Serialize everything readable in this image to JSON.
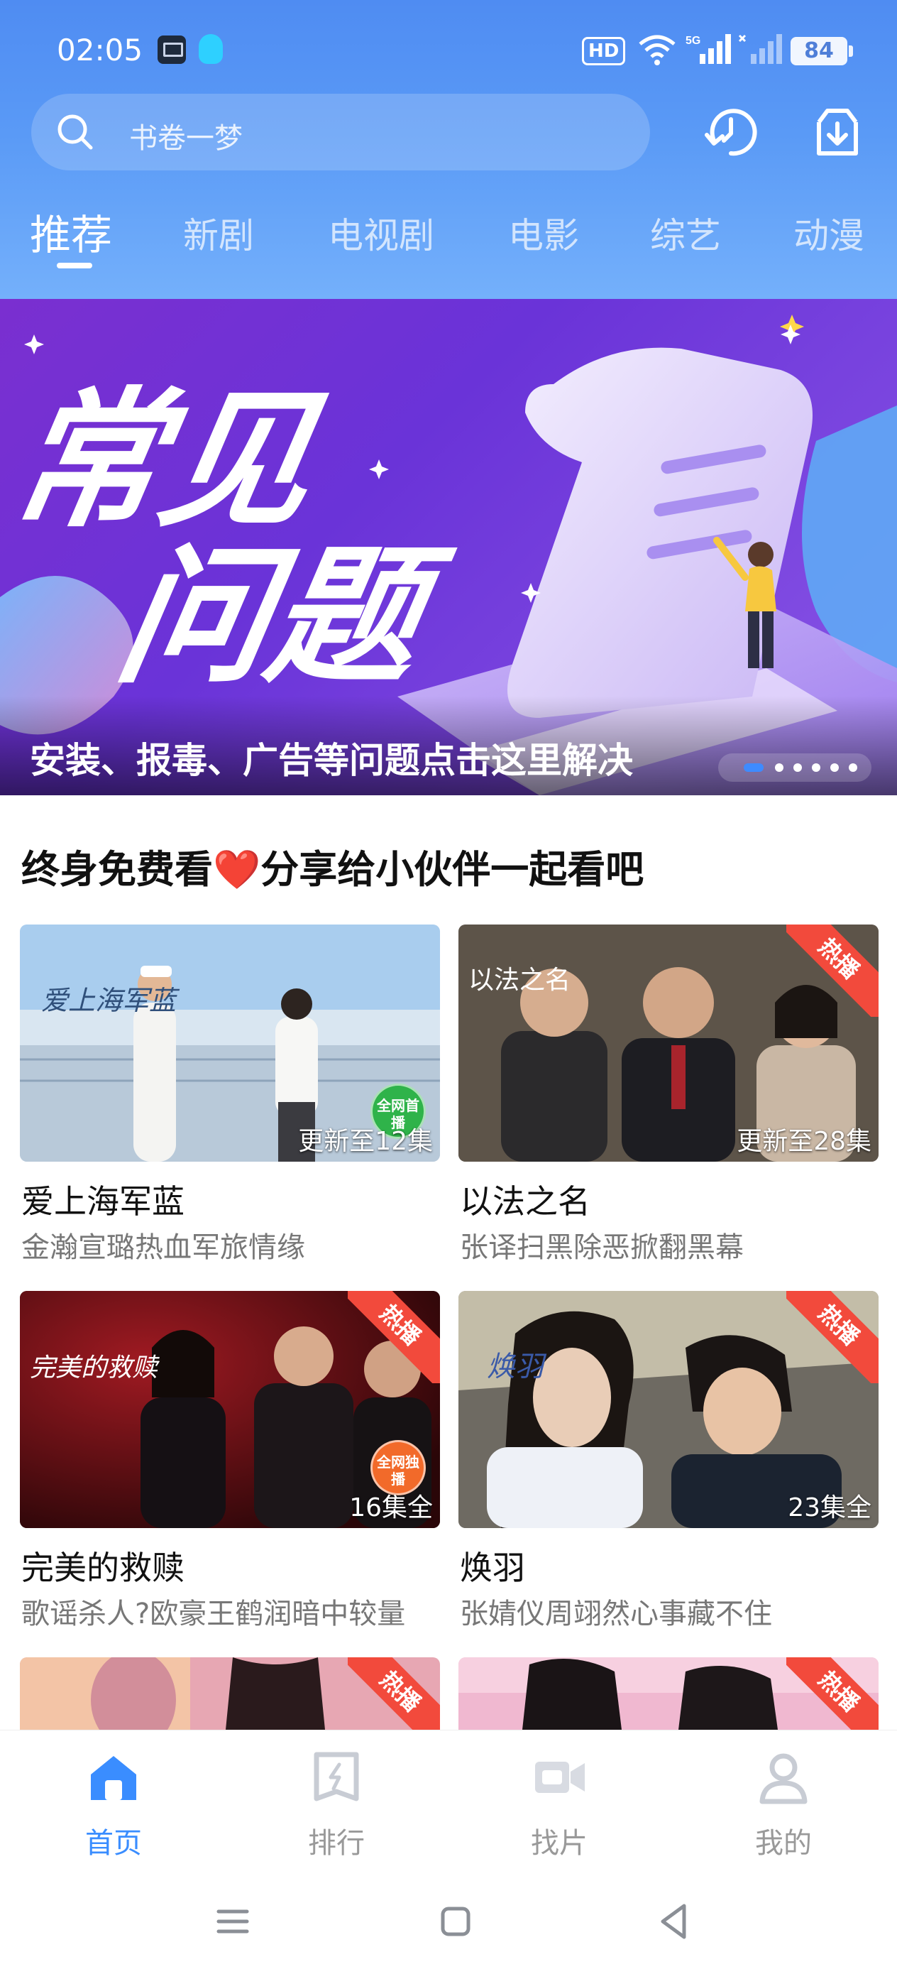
{
  "status_bar": {
    "time": "02:05",
    "hd_label": "HD",
    "network_label": "5G",
    "battery": "84"
  },
  "search": {
    "placeholder": "书卷一梦"
  },
  "tabs": [
    {
      "label": "推荐",
      "active": true
    },
    {
      "label": "新剧",
      "active": false
    },
    {
      "label": "电视剧",
      "active": false
    },
    {
      "label": "电影",
      "active": false
    },
    {
      "label": "综艺",
      "active": false
    },
    {
      "label": "动漫",
      "active": false
    }
  ],
  "banner": {
    "headline_line1": "常见",
    "headline_line2": "问题",
    "caption": "安装、报毒、广告等问题点击这里解决",
    "dots_count": 6,
    "active_dot": 0
  },
  "section": {
    "title_part1": "终身免费看",
    "heart": "❤️",
    "title_part2": "分享给小伙伴一起看吧"
  },
  "cards": [
    {
      "title": "爱上海军蓝",
      "subtitle": "金瀚宣璐热血军旅情缘",
      "badge": "更新至12集",
      "poster_text": "爱上海军蓝",
      "hot": false,
      "quanwang": "全网首播"
    },
    {
      "title": "以法之名",
      "subtitle": "张译扫黑除恶掀翻黑幕",
      "badge": "更新至28集",
      "poster_text": "以法之名",
      "hot": true,
      "hot_label": "热播"
    },
    {
      "title": "完美的救赎",
      "subtitle": "歌谣杀人?欧豪王鹤润暗中较量",
      "badge": "16集全",
      "poster_text": "完美的救赎",
      "hot": true,
      "hot_label": "热播",
      "quanwang": "全网独播"
    },
    {
      "title": "焕羽",
      "subtitle": "张婧仪周翊然心事藏不住",
      "badge": "23集全",
      "poster_text": "焕羽",
      "hot": true,
      "hot_label": "热播"
    }
  ],
  "partial_cards": [
    {
      "hot_label": "热播"
    },
    {
      "hot_label": "热播"
    }
  ],
  "bottom_nav": [
    {
      "label": "首页",
      "icon": "home-icon",
      "active": true
    },
    {
      "label": "排行",
      "icon": "ranking-icon",
      "active": false
    },
    {
      "label": "找片",
      "icon": "video-camera-icon",
      "active": false
    },
    {
      "label": "我的",
      "icon": "profile-icon",
      "active": false
    }
  ],
  "colors": {
    "accent": "#3a8dff",
    "header_top": "#4f8cf2",
    "hot_red": "#f24a3c"
  }
}
